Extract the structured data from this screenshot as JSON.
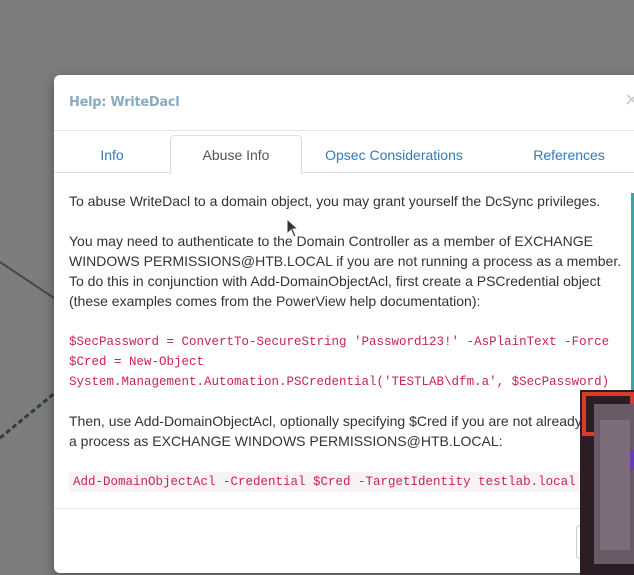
{
  "dialog": {
    "title": "Help: WriteDacl",
    "close_symbol": "×"
  },
  "tabs": [
    {
      "label": "Info",
      "active": false
    },
    {
      "label": "Abuse Info",
      "active": true
    },
    {
      "label": "Opsec Considerations",
      "active": false
    },
    {
      "label": "References",
      "active": false
    }
  ],
  "abuse_info": {
    "paragraph1": "To abuse WriteDacl to a domain object, you may grant yourself the DcSync privileges.",
    "paragraph2": "You may need to authenticate to the Domain Controller as a member of EXCHANGE WINDOWS PERMISSIONS@HTB.LOCAL if you are not running a process as a member. To do this in conjunction with Add-DomainObjectAcl, first create a PSCredential object (these examples comes from the PowerView help documentation):",
    "code1_line1": "$SecPassword = ConvertTo-SecureString 'Password123!' -AsPlainText -Force",
    "code1_line2": "$Cred = New-Object",
    "code1_line3": "System.Management.Automation.PSCredential('TESTLAB\\dfm.a', $SecPassword)",
    "paragraph3": "Then, use Add-DomainObjectAcl, optionally specifying $Cred if you are not already running a process as EXCHANGE WINDOWS PERMISSIONS@HTB.LOCAL:",
    "code2": "Add-DomainObjectAcl -Credential $Cred -TargetIdentity testlab.local"
  },
  "colors": {
    "title": "#8aaabd",
    "tab_link": "#337ab7",
    "code": "#c7254e",
    "backdrop": "#7d7d7d"
  }
}
